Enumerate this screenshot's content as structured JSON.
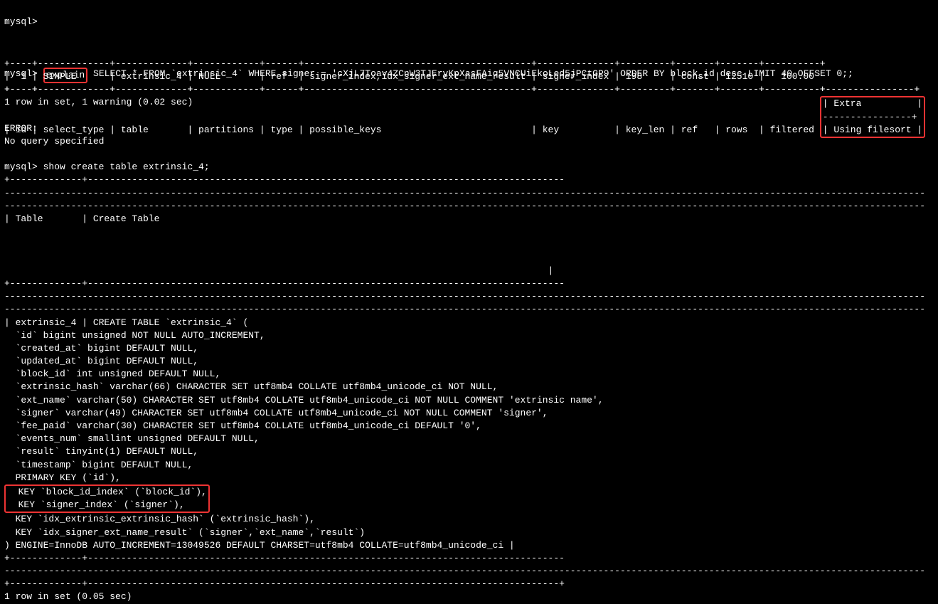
{
  "prompt": "mysql>",
  "explain": {
    "keyword": "explain",
    "query": " SELECT * FROM `extrinsic_4` WHERE signer = 'cXjL7Toav4ZCnW3TJEryKpXasFAiq5VNCUiEkoLed5jPCtGP9' ORDER BY block_id desc LIMIT 40 OFFSET 0;;",
    "sep_top": "+----+-------------+-------------+------------+------+-----------------------------------------+--------------+---------+-------+-------+----------+",
    "header_main": "| id | select_type | table       | partitions | type | possible_keys                           | key          | key_len | ref   | rows  | filtered ",
    "header_extra_top": "----------------+",
    "header_extra": "| Extra          |",
    "header_extra_bot": "----------------+",
    "sep_mid": "+----+-------------+-------------+------------+------+-----------------------------------------+--------------+---------+-------+-------+----------+",
    "row_main": "|  1 | SIMPLE      | extrinsic_4 | NULL       | ref  | signer_index,idx_signer_ext_name_result | signer_index | 198     | const | 12510 |   100.00 ",
    "row_extra": "| Using filesort |",
    "sep_bot": "+----+-------------+-------------+------------+------+-----------------------------------------+--------------+---------+-------+-------+----------+----------------+",
    "result": "1 row in set, 1 warning (0.02 sec)"
  },
  "error": {
    "l1": "ERROR:",
    "l2": "No query specified"
  },
  "showcreate": {
    "cmd": "mysql> show create table extrinsic_4;",
    "border1": "+-------------+--------------------------------------------------------------------------------------",
    "border_long": "----------------------------------------------------------------------------------------------------------------------------------------------------------------------",
    "border_long2": "----------------------------------------------------------------------------------------------------------------------------------------------------------------------",
    "header": "| Table       | Create Table",
    "blank": "                                                                                                  |",
    "row_start": "| extrinsic_4 | CREATE TABLE `extrinsic_4` (",
    "col_id": "  `id` bigint unsigned NOT NULL AUTO_INCREMENT,",
    "col_created": "  `created_at` bigint DEFAULT NULL,",
    "col_updated": "  `updated_at` bigint DEFAULT NULL,",
    "col_block": "  `block_id` int unsigned DEFAULT NULL,",
    "col_hash": "  `extrinsic_hash` varchar(66) CHARACTER SET utf8mb4 COLLATE utf8mb4_unicode_ci NOT NULL,",
    "col_ext": "  `ext_name` varchar(50) CHARACTER SET utf8mb4 COLLATE utf8mb4_unicode_ci NOT NULL COMMENT 'extrinsic name',",
    "col_signer": "  `signer` varchar(49) CHARACTER SET utf8mb4 COLLATE utf8mb4_unicode_ci NOT NULL COMMENT 'signer',",
    "col_fee": "  `fee_paid` varchar(30) CHARACTER SET utf8mb4 COLLATE utf8mb4_unicode_ci DEFAULT '0',",
    "col_events": "  `events_num` smallint unsigned DEFAULT NULL,",
    "col_result": "  `result` tinyint(1) DEFAULT NULL,",
    "col_ts": "  `timestamp` bigint DEFAULT NULL,",
    "pk": "  PRIMARY KEY (`id`),",
    "key_block": "  KEY `block_id_index` (`block_id`),",
    "key_signer": "  KEY `signer_index` (`signer`),",
    "key_hash": "  KEY `idx_extrinsic_extrinsic_hash` (`extrinsic_hash`),",
    "key_idx": "  KEY `idx_signer_ext_name_result` (`signer`,`ext_name`,`result`)",
    "engine": ") ENGINE=InnoDB AUTO_INCREMENT=13049526 DEFAULT CHARSET=utf8mb4 COLLATE=utf8mb4_unicode_ci |",
    "border_bot": "+-------------+-------------------------------------------------------------------------------------+",
    "result": "1 row in set (0.05 sec)"
  }
}
